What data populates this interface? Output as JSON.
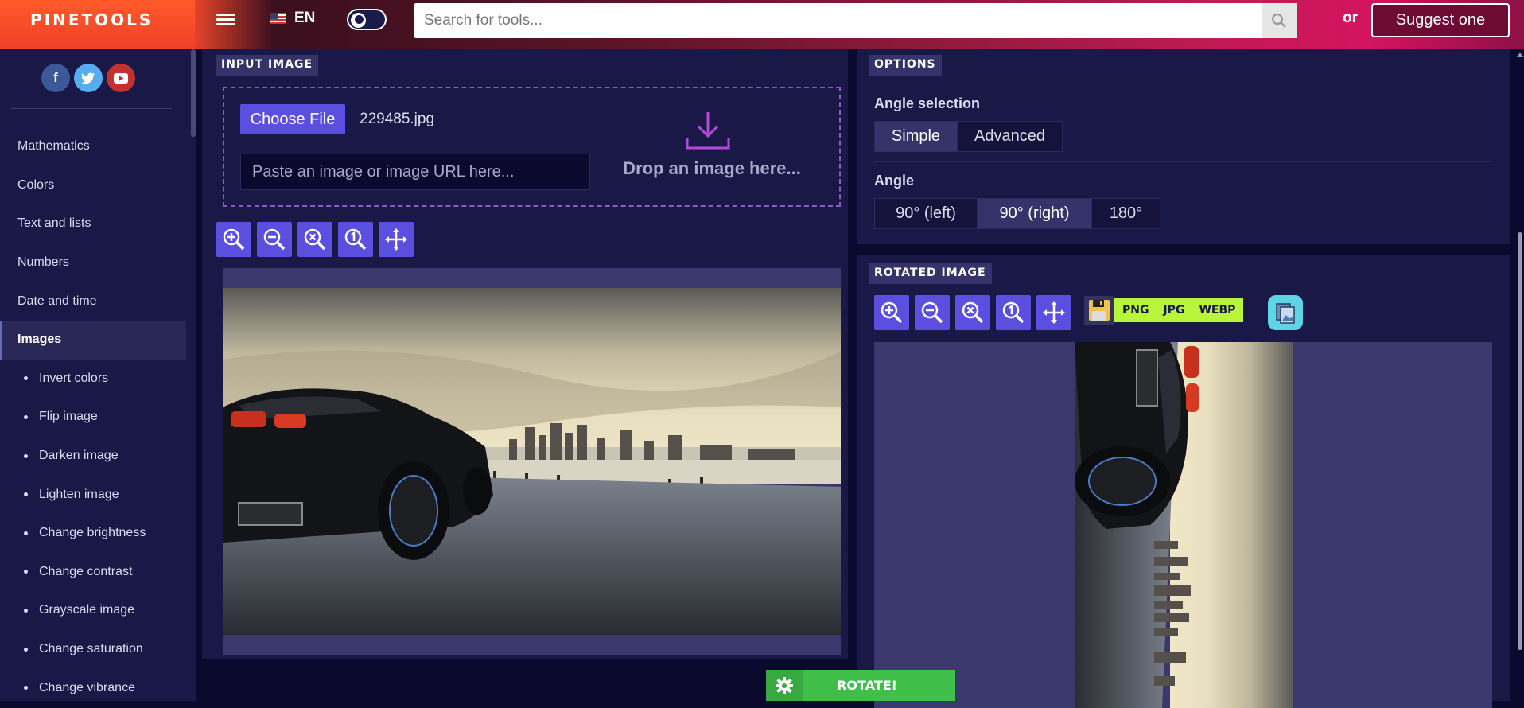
{
  "header": {
    "logo": "PINETOOLS",
    "language": "EN",
    "search_placeholder": "Search for tools...",
    "or_label": "or",
    "suggest_label": "Suggest one"
  },
  "sidebar": {
    "social": [
      {
        "name": "facebook-icon",
        "glyph": "f",
        "color": "#3b5998"
      },
      {
        "name": "twitter-icon",
        "glyph": "t",
        "color": "#55acee"
      },
      {
        "name": "youtube-icon",
        "glyph": "▶",
        "color": "#c4302b"
      }
    ],
    "categories": [
      "Mathematics",
      "Colors",
      "Text and lists",
      "Numbers",
      "Date and time",
      "Images"
    ],
    "active_category": "Images",
    "subitems": [
      "Invert colors",
      "Flip image",
      "Darken image",
      "Lighten image",
      "Change brightness",
      "Change contrast",
      "Grayscale image",
      "Change saturation",
      "Change vibrance"
    ]
  },
  "input_panel": {
    "title": "INPUT IMAGE",
    "choose_file_label": "Choose File",
    "file_name": "229485.jpg",
    "url_placeholder": "Paste an image or image URL here...",
    "drop_text": "Drop an image here..."
  },
  "options_panel": {
    "title": "OPTIONS",
    "angle_selection_label": "Angle selection",
    "angle_selection_options": [
      "Simple",
      "Advanced"
    ],
    "angle_selection_selected": "Simple",
    "angle_label": "Angle",
    "angle_options": [
      "90° (left)",
      "90° (right)",
      "180°"
    ],
    "angle_selected": "90° (right)"
  },
  "rotated_panel": {
    "title": "ROTATED IMAGE",
    "formats": [
      "PNG",
      "JPG",
      "WEBP"
    ]
  },
  "toolbar_icons": [
    "zoom-in-icon",
    "zoom-out-icon",
    "zoom-reset-icon",
    "zoom-actual-icon",
    "move-icon"
  ],
  "rotate_button_label": "ROTATE!",
  "colors": {
    "accent": "#5b4fe0",
    "panel": "#1a1846",
    "background": "#0b0a2e",
    "rotate_green": "#3fbf4a",
    "format_green": "#b9f53a"
  }
}
